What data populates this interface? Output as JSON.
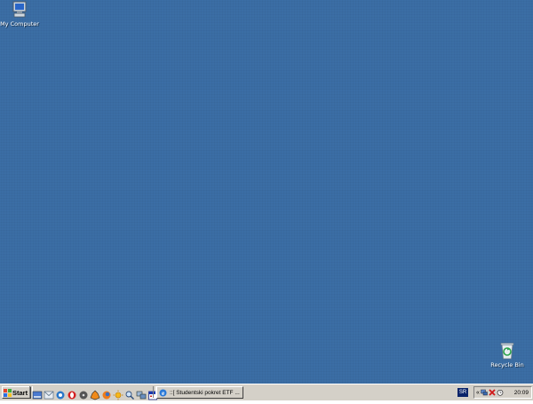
{
  "desktop": {
    "icons": [
      {
        "label": "My Computer",
        "icon": "my-computer-icon"
      },
      {
        "label": "Recycle Bin",
        "icon": "recycle-bin-icon"
      }
    ],
    "background_color": "#3b6ea5"
  },
  "taskbar": {
    "start_label": "Start",
    "quick_launch": [
      "show-desktop-icon",
      "outlook-express-icon",
      "messenger-icon",
      "opera-icon",
      "media-player-icon",
      "winamp-icon",
      "firefox-icon",
      "sun-icon",
      "search-icon",
      "network-icon",
      "calendar-icon"
    ],
    "task_window": {
      "title": "::[ Studentski pokret ETF ...",
      "icon": "internet-explorer-icon"
    },
    "language": "SR",
    "tray": {
      "chevron": "«",
      "icons": [
        "network-tray-icon",
        "antivirus-tray-icon",
        "alarm-tray-icon"
      ],
      "clock": "20:09"
    }
  }
}
